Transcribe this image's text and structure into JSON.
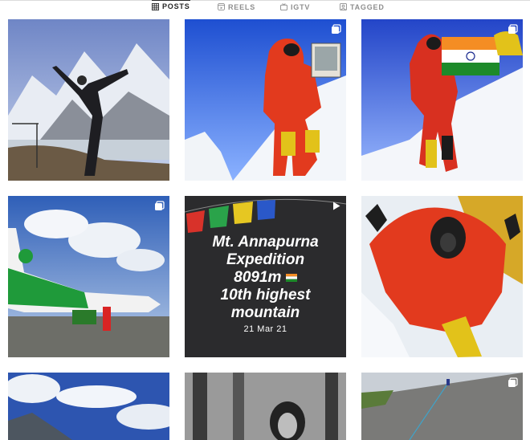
{
  "tabs": [
    {
      "label": "POSTS",
      "icon": "grid-icon",
      "active": true
    },
    {
      "label": "REELS",
      "icon": "reels-icon",
      "active": false
    },
    {
      "label": "IGTV",
      "icon": "igtv-icon",
      "active": false
    },
    {
      "label": "TAGGED",
      "icon": "tagged-icon",
      "active": false
    }
  ],
  "posts": [
    {
      "id": "yoga-pose-mountains",
      "badge": "none"
    },
    {
      "id": "summit-climber-with-photo",
      "badge": "carousel-icon"
    },
    {
      "id": "summit-climber-with-india-flag",
      "badge": "carousel-icon"
    },
    {
      "id": "airplane-on-tarmac",
      "badge": "carousel-icon"
    },
    {
      "id": "expedition-card",
      "badge": "video-icon"
    },
    {
      "id": "climber-in-oxygen-mask",
      "badge": "none"
    },
    {
      "id": "clouds-over-mountains",
      "badge": "none"
    },
    {
      "id": "portrait-in-forest",
      "badge": "none"
    },
    {
      "id": "rock-slab-climbing",
      "badge": "carousel-icon"
    }
  ],
  "expedition_card": {
    "line1": "Mt. Annapurna",
    "line2": "Expedition",
    "line3": "8091m",
    "line4": "10th highest",
    "line5": "mountain",
    "date": "21 Mar 21"
  },
  "colors": {
    "active_tab": "#262626",
    "inactive_tab": "#8e8e8e",
    "card_bg": "#2b2b2d",
    "down_suit": "#e23a1e"
  }
}
